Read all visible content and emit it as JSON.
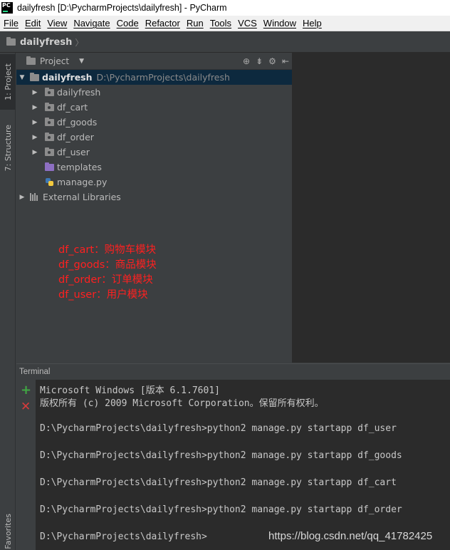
{
  "window": {
    "title": "dailyfresh [D:\\PycharmProjects\\dailyfresh] - PyCharm",
    "logo_text": "PC"
  },
  "menu": [
    "File",
    "Edit",
    "View",
    "Navigate",
    "Code",
    "Refactor",
    "Run",
    "Tools",
    "VCS",
    "Window",
    "Help"
  ],
  "breadcrumb": {
    "root": "dailyfresh"
  },
  "left_tabs": {
    "project": "1: Project",
    "structure": "7: Structure",
    "favorites": "Favorites"
  },
  "project_panel": {
    "view_label": "Project",
    "tree": {
      "root": {
        "name": "dailyfresh",
        "path": "D:\\PycharmProjects\\dailyfresh"
      },
      "children": [
        {
          "name": "dailyfresh",
          "type": "package"
        },
        {
          "name": "df_cart",
          "type": "package"
        },
        {
          "name": "df_goods",
          "type": "package"
        },
        {
          "name": "df_order",
          "type": "package"
        },
        {
          "name": "df_user",
          "type": "package"
        },
        {
          "name": "templates",
          "type": "templates-folder"
        },
        {
          "name": "manage.py",
          "type": "python-file"
        }
      ],
      "external": "External Libraries"
    }
  },
  "annotations": [
    "df_cart：购物车模块",
    "df_goods：商品模块",
    "df_order：订单模块",
    "df_user：用户模块"
  ],
  "terminal": {
    "title": "Terminal",
    "lines": [
      "Microsoft Windows [版本 6.1.7601]",
      "版权所有 (c) 2009 Microsoft Corporation。保留所有权利。",
      "D:\\PycharmProjects\\dailyfresh>python2 manage.py startapp df_user",
      "D:\\PycharmProjects\\dailyfresh>python2 manage.py startapp df_goods",
      "D:\\PycharmProjects\\dailyfresh>python2 manage.py startapp df_cart",
      "D:\\PycharmProjects\\dailyfresh>python2 manage.py startapp df_order",
      "D:\\PycharmProjects\\dailyfresh>"
    ]
  },
  "watermark": "https://blog.csdn.net/qq_41782425"
}
